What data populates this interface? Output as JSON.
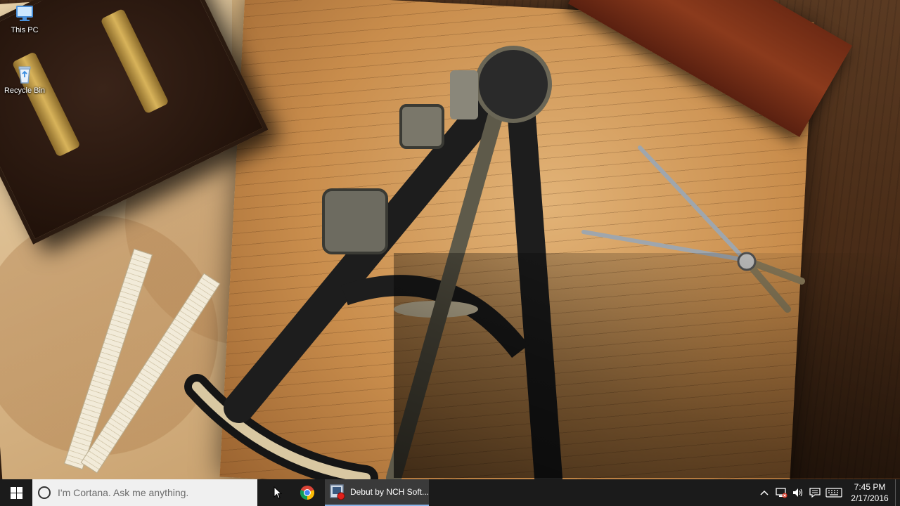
{
  "desktop": {
    "icons": [
      {
        "label": "This PC",
        "icon": "computer-icon"
      },
      {
        "label": "Recycle Bin",
        "icon": "recycle-bin-icon"
      }
    ]
  },
  "taskbar": {
    "start_icon": "windows-logo-icon",
    "search_placeholder": "I'm Cortana. Ask me anything.",
    "apps": [
      {
        "name": "cursor",
        "icon": "mouse-pointer-icon"
      },
      {
        "name": "chrome",
        "icon": "chrome-icon"
      },
      {
        "name": "debut",
        "label": "Debut by NCH Soft...",
        "icon": "debut-recorder-icon"
      }
    ],
    "tray": {
      "icons": [
        "chevron-up-icon",
        "network-icon",
        "volume-icon",
        "action-center-icon",
        "keyboard-icon"
      ],
      "time": "7:45 PM",
      "date": "2/17/2016"
    }
  },
  "colors": {
    "taskbar_bg": "#1b1b1b",
    "search_bg": "#f0f0f0",
    "active_app_underline": "#8ab4e8"
  }
}
